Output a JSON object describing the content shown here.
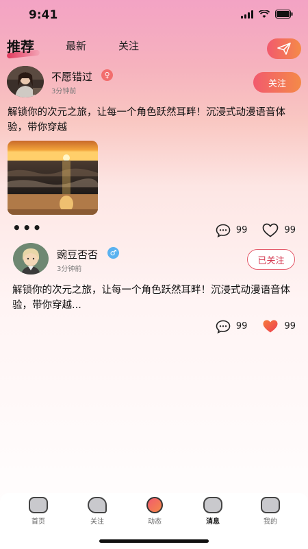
{
  "status_bar": {
    "time": "9:41"
  },
  "top_nav": {
    "tabs": [
      {
        "label": "推荐",
        "active": true
      },
      {
        "label": "最新",
        "active": false
      },
      {
        "label": "关注",
        "active": false
      }
    ],
    "send_icon": "paper-plane-icon"
  },
  "posts": [
    {
      "username": "不愿错过",
      "gender": "female",
      "gender_symbol": "♀",
      "time": "3分钟前",
      "follow_label": "关注",
      "text": "解锁你的次元之旅，让每一个角色跃然耳畔！沉浸式动漫语音体验，带你穿越",
      "has_image": true,
      "comments": "99",
      "likes": "99",
      "liked": false
    },
    {
      "username": "豌豆否否",
      "gender": "male",
      "gender_symbol": "♂",
      "time": "3分钟前",
      "follow_label": "已关注",
      "text": "解锁你的次元之旅，让每一个角色跃然耳畔！沉浸式动漫语音体验，带你穿越...",
      "has_image": false,
      "comments": "99",
      "likes": "99",
      "liked": true
    }
  ],
  "bottom_nav": [
    {
      "label": "首页",
      "icon": "home-icon",
      "active": false
    },
    {
      "label": "关注",
      "icon": "follow-icon",
      "active": false
    },
    {
      "label": "动态",
      "icon": "feed-icon",
      "active": false
    },
    {
      "label": "消息",
      "icon": "message-icon",
      "active": true
    },
    {
      "label": "我的",
      "icon": "profile-icon",
      "active": false
    }
  ],
  "colors": {
    "accent_start": "#f25a6e",
    "accent_end": "#f48a48",
    "like_red": "#ee3f52"
  }
}
